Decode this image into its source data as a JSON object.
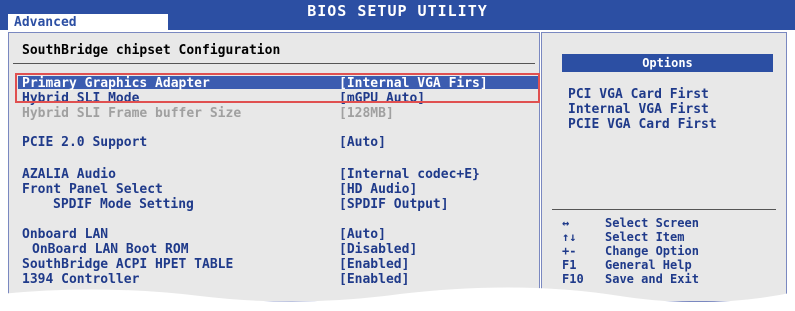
{
  "header": {
    "title": "BIOS SETUP UTILITY",
    "active_tab": "Advanced"
  },
  "main": {
    "section_title": "SouthBridge chipset Configuration",
    "rows": [
      {
        "label": "Primary Graphics Adapter",
        "value": "[Internal VGA Firs]"
      },
      {
        "label": "Hybrid SLI Mode",
        "value": "[mGPU Auto]"
      },
      {
        "label": "Hybrid SLI Frame buffer Size",
        "value": "[128MB]"
      },
      {
        "label": "PCIE 2.0 Support",
        "value": "[Auto]"
      },
      {
        "label": "AZALIA Audio",
        "value": "[Internal codec+E}"
      },
      {
        "label": "Front Panel Select",
        "value": "[HD Audio]"
      },
      {
        "label": "SPDIF Mode Setting",
        "value": "[SPDIF Output]"
      },
      {
        "label": "Onboard LAN",
        "value": "[Auto]"
      },
      {
        "label": "OnBoard LAN Boot ROM",
        "value": "[Disabled]"
      },
      {
        "label": "SouthBridge ACPI HPET TABLE",
        "value": "[Enabled]"
      },
      {
        "label": "1394 Controller",
        "value": "[Enabled]"
      }
    ]
  },
  "sidebar": {
    "options_title": "Options",
    "options": [
      "PCI VGA Card First",
      "Internal VGA First",
      "PCIE VGA Card First"
    ],
    "help": [
      {
        "key": "↔",
        "action": "Select Screen"
      },
      {
        "key": "↑↓",
        "action": "Select Item"
      },
      {
        "key": "+-",
        "action": "Change Option"
      },
      {
        "key": "F1",
        "action": "General Help"
      },
      {
        "key": "F10",
        "action": "Save and Exit"
      }
    ]
  }
}
